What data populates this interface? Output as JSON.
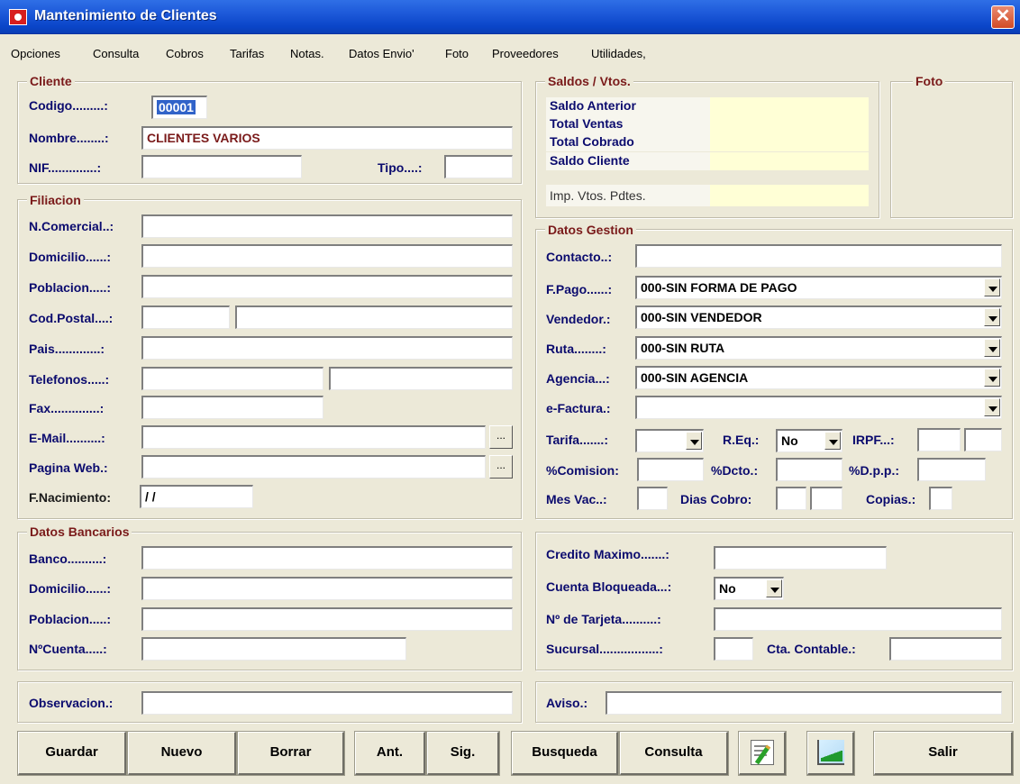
{
  "window": {
    "title": "Mantenimiento de Clientes",
    "close": "✕"
  },
  "menu": [
    "Opciones",
    "Consulta",
    "Cobros",
    "Tarifas",
    "Notas.",
    "Datos Envio'",
    "Foto",
    "Proveedores",
    "Utilidades,"
  ],
  "cliente": {
    "legend": "Cliente",
    "codigo_label": "Codigo.........:",
    "codigo_value": "00001",
    "nombre_label": "Nombre........:",
    "nombre_value": "CLIENTES VARIOS",
    "nif_label": "NIF..............:",
    "tipo_label": "Tipo....:"
  },
  "saldos": {
    "legend": "Saldos / Vtos.",
    "rows": [
      "Saldo Anterior",
      "Total Ventas",
      "Total Cobrado",
      "Saldo Cliente"
    ],
    "imp_label": "Imp. Vtos. Pdtes."
  },
  "foto": {
    "legend": "Foto"
  },
  "filiacion": {
    "legend": "Filiacion",
    "comercial": "N.Comercial..:",
    "domicilio": "Domicilio......:",
    "poblacion": "Poblacion.....:",
    "cod_postal": "Cod.Postal....:",
    "pais": "Pais.............:",
    "telefonos": "Telefonos.....:",
    "fax": "Fax..............:",
    "email": "E-Mail..........:",
    "pagina_web": "Pagina Web.:",
    "nacimiento": "F.Nacimiento:",
    "nacimiento_value": " /  /",
    "dots": "..."
  },
  "gestion": {
    "legend": "Datos Gestion",
    "contacto": "Contacto..:",
    "fpago": "F.Pago......:",
    "fpago_value": "000-SIN FORMA DE PAGO",
    "vendedor": "Vendedor.:",
    "vendedor_value": "000-SIN VENDEDOR",
    "ruta": "Ruta........:",
    "ruta_value": "000-SIN RUTA",
    "agencia": "Agencia...:",
    "agencia_value": "000-SIN AGENCIA",
    "efactura": "e-Factura.:",
    "tarifa": "Tarifa.......:",
    "req": "R.Eq.:",
    "req_value": "No",
    "irpf": "IRPF...:",
    "comision": "%Comision:",
    "dcto": "%Dcto.:",
    "dpp": "%D.p.p.:",
    "mesvac": "Mes Vac..:",
    "diascobro": "Dias Cobro:",
    "copias": "Copias.:"
  },
  "bancarios": {
    "legend": "Datos Bancarios",
    "banco": "Banco..........:",
    "domicilio": "Domicilio......:",
    "poblacion": "Poblacion.....:",
    "cuenta": "NºCuenta.....:"
  },
  "credito": {
    "credito_max": "Credito Maximo.......:",
    "bloqueada": "Cuenta Bloqueada...:",
    "bloqueada_value": "No",
    "tarjeta": "Nº de Tarjeta..........:",
    "sucursal": "Sucursal.................:",
    "cta_contable": "Cta. Contable.:"
  },
  "observacion": "Observacion.:",
  "aviso": "Aviso.:",
  "buttons": {
    "guardar": "Guardar",
    "nuevo": "Nuevo",
    "borrar": "Borrar",
    "ant": "Ant.",
    "sig": "Sig.",
    "busqueda": "Busqueda",
    "consulta": "Consulta",
    "salir": "Salir"
  }
}
